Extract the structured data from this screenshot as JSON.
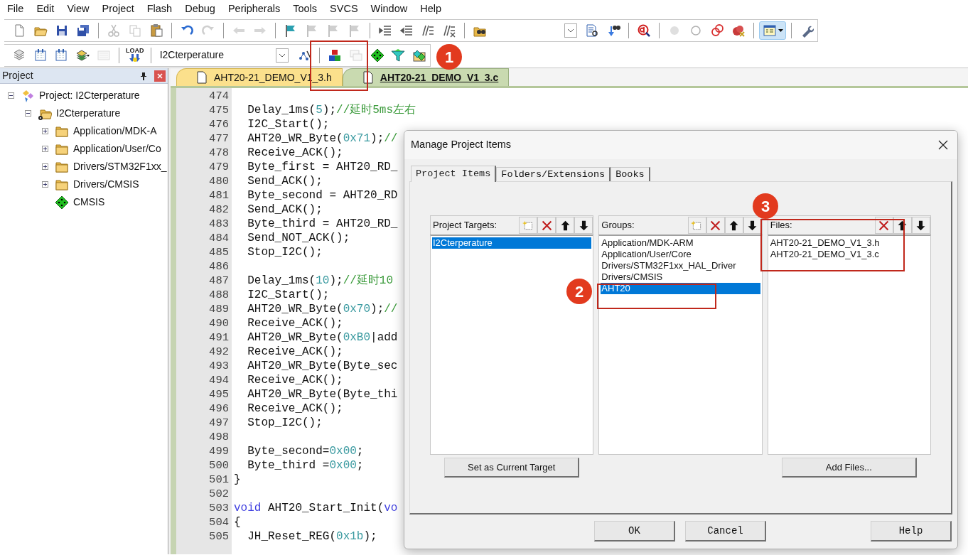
{
  "menu": [
    "File",
    "Edit",
    "View",
    "Project",
    "Flash",
    "Debug",
    "Peripherals",
    "Tools",
    "SVCS",
    "Window",
    "Help"
  ],
  "toolbar_1": [
    {
      "kind": "new",
      "disabled": false
    },
    {
      "kind": "open",
      "disabled": false
    },
    {
      "kind": "save",
      "disabled": false
    },
    {
      "kind": "save-all",
      "disabled": false
    },
    {
      "kind": "separator"
    },
    {
      "kind": "cut",
      "disabled": true
    },
    {
      "kind": "copy",
      "disabled": true
    },
    {
      "kind": "paste",
      "disabled": false
    },
    {
      "kind": "separator"
    },
    {
      "kind": "undo",
      "disabled": false
    },
    {
      "kind": "redo",
      "disabled": true
    },
    {
      "kind": "separator"
    },
    {
      "kind": "back",
      "disabled": true
    },
    {
      "kind": "forward",
      "disabled": true
    },
    {
      "kind": "separator"
    },
    {
      "kind": "flag",
      "disabled": false
    },
    {
      "kind": "flag",
      "disabled": true
    },
    {
      "kind": "flag",
      "disabled": true
    },
    {
      "kind": "flag",
      "disabled": true
    },
    {
      "kind": "separator"
    },
    {
      "kind": "indent",
      "disabled": false
    },
    {
      "kind": "unindent",
      "disabled": false
    },
    {
      "kind": "comment",
      "disabled": false
    },
    {
      "kind": "uncomment",
      "disabled": false
    },
    {
      "kind": "separator"
    },
    {
      "kind": "find-files",
      "disabled": false
    },
    {
      "kind": "combo",
      "disabled": false
    },
    {
      "kind": "find",
      "disabled": false
    },
    {
      "kind": "binoculars",
      "disabled": false
    },
    {
      "kind": "separator"
    },
    {
      "kind": "debug",
      "disabled": false
    },
    {
      "kind": "separator"
    },
    {
      "kind": "dot",
      "disabled": true
    },
    {
      "kind": "ring",
      "disabled": false
    },
    {
      "kind": "rings",
      "disabled": false
    },
    {
      "kind": "dot-x",
      "disabled": false
    },
    {
      "kind": "separator"
    },
    {
      "kind": "window",
      "disabled": false
    },
    {
      "kind": "separator"
    },
    {
      "kind": "wrench",
      "disabled": false
    }
  ],
  "toolbar_2": [
    {
      "kind": "stack",
      "disabled": false
    },
    {
      "kind": "build",
      "disabled": false
    },
    {
      "kind": "build",
      "disabled": false
    },
    {
      "kind": "batch",
      "disabled": false
    },
    {
      "kind": "stop",
      "disabled": true
    },
    {
      "kind": "separator"
    },
    {
      "kind": "load",
      "label": "LOAD",
      "disabled": false
    },
    {
      "kind": "separator"
    },
    {
      "kind": "target",
      "value": "I2Cterperature"
    },
    {
      "kind": "wand",
      "disabled": false
    },
    {
      "kind": "separator"
    },
    {
      "kind": "blocks",
      "disabled": false
    },
    {
      "kind": "windows",
      "disabled": true
    },
    {
      "kind": "diamond",
      "disabled": false
    },
    {
      "kind": "funnel",
      "disabled": false
    },
    {
      "kind": "diamonds",
      "disabled": false
    }
  ],
  "project_panel": {
    "title": "Project",
    "tree": [
      {
        "label": "Project: I2Cterperature",
        "kind": "project",
        "expanded": true,
        "children": [
          {
            "label": "I2Cterperature",
            "kind": "group",
            "expanded": true,
            "children": [
              {
                "label": "Application/MDK-A",
                "kind": "folder",
                "expanded": false
              },
              {
                "label": "Application/User/Co",
                "kind": "folder",
                "expanded": false
              },
              {
                "label": "Drivers/STM32F1xx_",
                "kind": "folder",
                "expanded": false
              },
              {
                "label": "Drivers/CMSIS",
                "kind": "folder",
                "expanded": false
              },
              {
                "label": "CMSIS",
                "kind": "component"
              }
            ]
          }
        ]
      }
    ]
  },
  "editor": {
    "tabs": [
      {
        "label": "AHT20-21_DEMO_V1_3.h",
        "selected": false
      },
      {
        "label": "AHT20-21_DEMO_V1_3.c",
        "selected": true
      }
    ],
    "lines": [
      {
        "number": "474"
      },
      {
        "number": "475",
        "segments": [
          {
            "text": "  Delay_1ms(",
            "kind": "plain"
          },
          {
            "text": "5",
            "kind": "number"
          },
          {
            "text": ");",
            "kind": "plain"
          },
          {
            "text": "//延时5ms左右",
            "kind": "comment"
          }
        ]
      },
      {
        "number": "476",
        "code": "  I2C_Start();"
      },
      {
        "number": "477",
        "segments": [
          {
            "text": "  AHT20_WR_Byte(",
            "kind": "plain"
          },
          {
            "text": "0x71",
            "kind": "number"
          },
          {
            "text": ");",
            "kind": "plain"
          },
          {
            "text": "//",
            "kind": "comment"
          }
        ]
      },
      {
        "number": "478",
        "code": "  Receive_ACK();"
      },
      {
        "number": "479",
        "code": "  Byte_first = AHT20_RD_"
      },
      {
        "number": "480",
        "code": "  Send_ACK();"
      },
      {
        "number": "481",
        "code": "  Byte_second = AHT20_RD"
      },
      {
        "number": "482",
        "code": "  Send_ACK();"
      },
      {
        "number": "483",
        "code": "  Byte_third = AHT20_RD_"
      },
      {
        "number": "484",
        "code": "  Send_NOT_ACK();"
      },
      {
        "number": "485",
        "code": "  Stop_I2C();"
      },
      {
        "number": "486"
      },
      {
        "number": "487",
        "segments": [
          {
            "text": "  Delay_1ms(",
            "kind": "plain"
          },
          {
            "text": "10",
            "kind": "number"
          },
          {
            "text": ");",
            "kind": "plain"
          },
          {
            "text": "//延时10",
            "kind": "comment"
          }
        ]
      },
      {
        "number": "488",
        "code": "  I2C_Start();"
      },
      {
        "number": "489",
        "segments": [
          {
            "text": "  AHT20_WR_Byte(",
            "kind": "plain"
          },
          {
            "text": "0x70",
            "kind": "number"
          },
          {
            "text": ");",
            "kind": "plain"
          },
          {
            "text": "//",
            "kind": "comment"
          }
        ]
      },
      {
        "number": "490",
        "code": "  Receive_ACK();"
      },
      {
        "number": "491",
        "segments": [
          {
            "text": "  AHT20_WR_Byte(",
            "kind": "plain"
          },
          {
            "text": "0xB0",
            "kind": "number"
          },
          {
            "text": "|add",
            "kind": "plain"
          }
        ]
      },
      {
        "number": "492",
        "code": "  Receive_ACK();"
      },
      {
        "number": "493",
        "code": "  AHT20_WR_Byte(Byte_sec"
      },
      {
        "number": "494",
        "code": "  Receive_ACK();"
      },
      {
        "number": "495",
        "code": "  AHT20_WR_Byte(Byte_thi"
      },
      {
        "number": "496",
        "code": "  Receive_ACK();"
      },
      {
        "number": "497",
        "code": "  Stop_I2C();"
      },
      {
        "number": "498"
      },
      {
        "number": "499",
        "segments": [
          {
            "text": "  Byte_second=",
            "kind": "plain"
          },
          {
            "text": "0x00",
            "kind": "number"
          },
          {
            "text": ";",
            "kind": "plain"
          }
        ]
      },
      {
        "number": "500",
        "segments": [
          {
            "text": "  Byte_third =",
            "kind": "plain"
          },
          {
            "text": "0x00",
            "kind": "number"
          },
          {
            "text": ";",
            "kind": "plain"
          }
        ]
      },
      {
        "number": "501",
        "code": "}"
      },
      {
        "number": "502"
      },
      {
        "number": "503",
        "segments": [
          {
            "text": "void",
            "kind": "keyword"
          },
          {
            "text": " AHT20_Start_Init(",
            "kind": "plain"
          },
          {
            "text": "vo",
            "kind": "keyword"
          }
        ]
      },
      {
        "number": "504",
        "code": "{"
      },
      {
        "number": "505",
        "segments": [
          {
            "text": "  JH_Reset_REG(",
            "kind": "plain"
          },
          {
            "text": "0x1b",
            "kind": "number"
          },
          {
            "text": ");",
            "kind": "plain"
          }
        ]
      }
    ]
  },
  "dialog": {
    "title": "Manage Project Items",
    "tabs": [
      {
        "label": "Project Items",
        "selected": true
      },
      {
        "label": "Folders/Extensions",
        "selected": false
      },
      {
        "label": "Books",
        "selected": false
      }
    ],
    "panels": [
      {
        "label": "Project Targets:",
        "tools": [
          {
            "kind": "new"
          },
          {
            "kind": "delete"
          },
          {
            "kind": "up"
          },
          {
            "kind": "down"
          }
        ],
        "items": [
          {
            "text": "I2Cterperature",
            "selected": true
          }
        ],
        "button": "Set as Current Target"
      },
      {
        "label": "Groups:",
        "tools": [
          {
            "kind": "new"
          },
          {
            "kind": "delete"
          },
          {
            "kind": "up"
          },
          {
            "kind": "down"
          }
        ],
        "items": [
          {
            "text": "Application/MDK-ARM",
            "selected": false
          },
          {
            "text": "Application/User/Core",
            "selected": false
          },
          {
            "text": "Drivers/STM32F1xx_HAL_Driver",
            "selected": false
          },
          {
            "text": "Drivers/CMSIS",
            "selected": false
          },
          {
            "text": "AHT20",
            "selected": true
          }
        ]
      },
      {
        "label": "Files:",
        "tools": [
          {
            "kind": "delete"
          },
          {
            "kind": "up"
          },
          {
            "kind": "down"
          }
        ],
        "items": [
          {
            "text": "AHT20-21_DEMO_V1_3.h",
            "selected": false
          },
          {
            "text": "AHT20-21_DEMO_V1_3.c",
            "selected": false
          }
        ],
        "button": "Add Files..."
      }
    ],
    "footer_buttons": [
      "OK",
      "Cancel",
      "Help"
    ]
  },
  "annotations": [
    {
      "number": "1"
    },
    {
      "number": "2"
    },
    {
      "number": "3"
    }
  ]
}
